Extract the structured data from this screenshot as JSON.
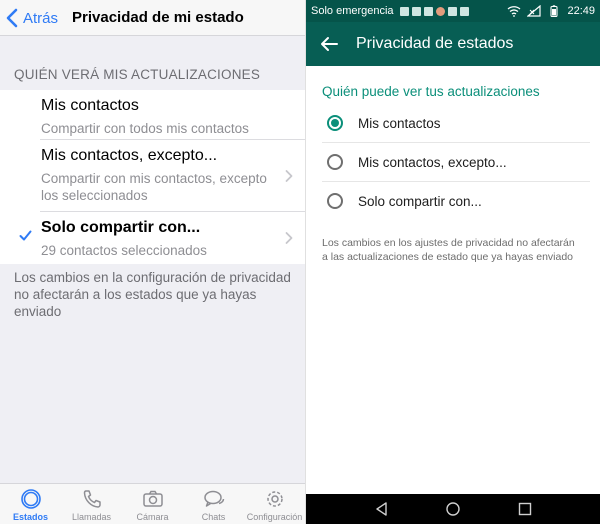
{
  "ios": {
    "nav": {
      "back_label": "Atrás",
      "title": "Privacidad de mi estado"
    },
    "section_header": "QUIÉN VERÁ MIS ACTUALIZACIONES",
    "options": [
      {
        "title": "Mis contactos",
        "subtitle": "Compartir con todos mis contactos"
      },
      {
        "title": "Mis contactos, excepto...",
        "subtitle": "Compartir con mis contactos, excepto los seleccionados"
      },
      {
        "title": "Solo compartir con...",
        "subtitle": "29 contactos seleccionados",
        "selected": true
      }
    ],
    "footer": "Los cambios en la configuración de privacidad no afectarán a los estados que ya hayas enviado",
    "tabs": [
      {
        "label": "Estados",
        "icon": "status-icon",
        "active": true
      },
      {
        "label": "Llamadas",
        "icon": "phone-icon"
      },
      {
        "label": "Cámara",
        "icon": "camera-icon"
      },
      {
        "label": "Chats",
        "icon": "chat-bubbles-icon"
      },
      {
        "label": "Configuración",
        "icon": "gear-icon"
      }
    ],
    "colors": {
      "accent": "#2f7bf5",
      "background": "#efeff4"
    }
  },
  "android": {
    "status_bar": {
      "carrier": "Solo emergencia",
      "time": "22:49"
    },
    "app_bar": {
      "title": "Privacidad de estados"
    },
    "section_header": "Quién puede ver tus actualizaciones",
    "options": [
      {
        "label": "Mis contactos",
        "selected": true
      },
      {
        "label": "Mis contactos, excepto...",
        "selected": false
      },
      {
        "label": "Solo compartir con...",
        "selected": false
      }
    ],
    "note": "Los cambios en los ajustes de privacidad no afectarán a las actualizaciones de estado que ya hayas enviado",
    "colors": {
      "primary": "#075e54",
      "status_bar": "#05544a",
      "accent": "#0b8f7a"
    }
  }
}
